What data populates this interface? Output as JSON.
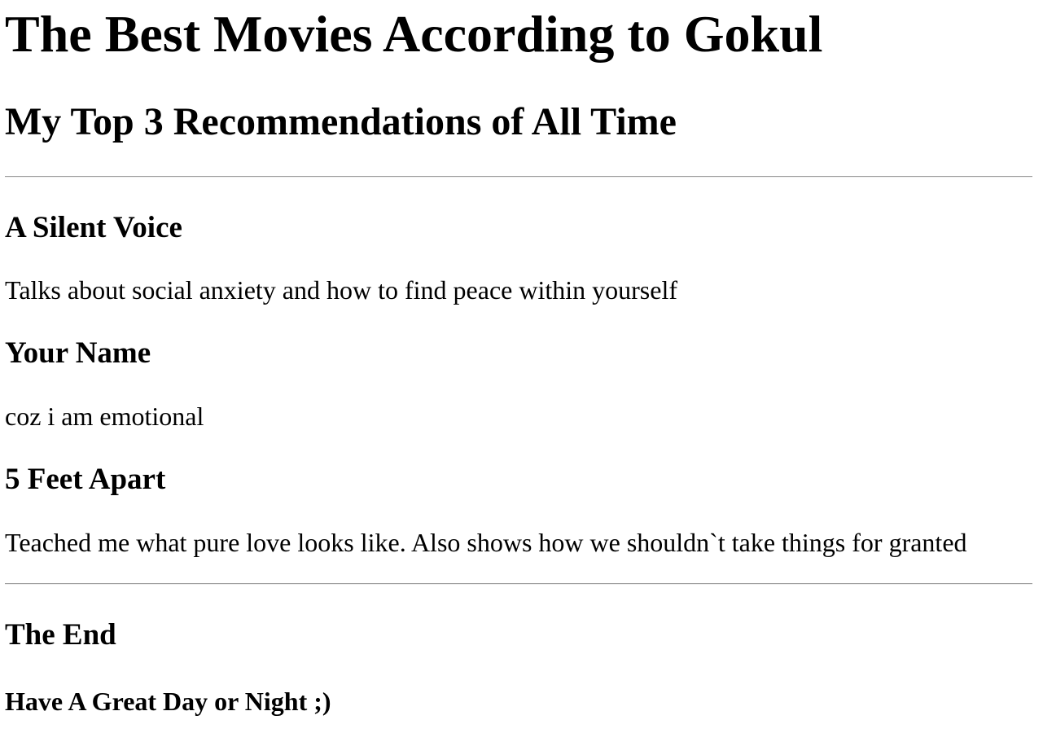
{
  "title": "The Best Movies According to Gokul",
  "subtitle": "My Top 3 Recommendations of All Time",
  "movies": [
    {
      "name": "A Silent Voice",
      "reason": "Talks about social anxiety and how to find peace within yourself"
    },
    {
      "name": "Your Name",
      "reason": "coz i am emotional"
    },
    {
      "name": "5 Feet Apart",
      "reason": "Teached me what pure love looks like. Also shows how we shouldn`t take things for granted"
    }
  ],
  "footer": {
    "heading": "The End",
    "message": "Have A Great Day or Night ;)"
  }
}
